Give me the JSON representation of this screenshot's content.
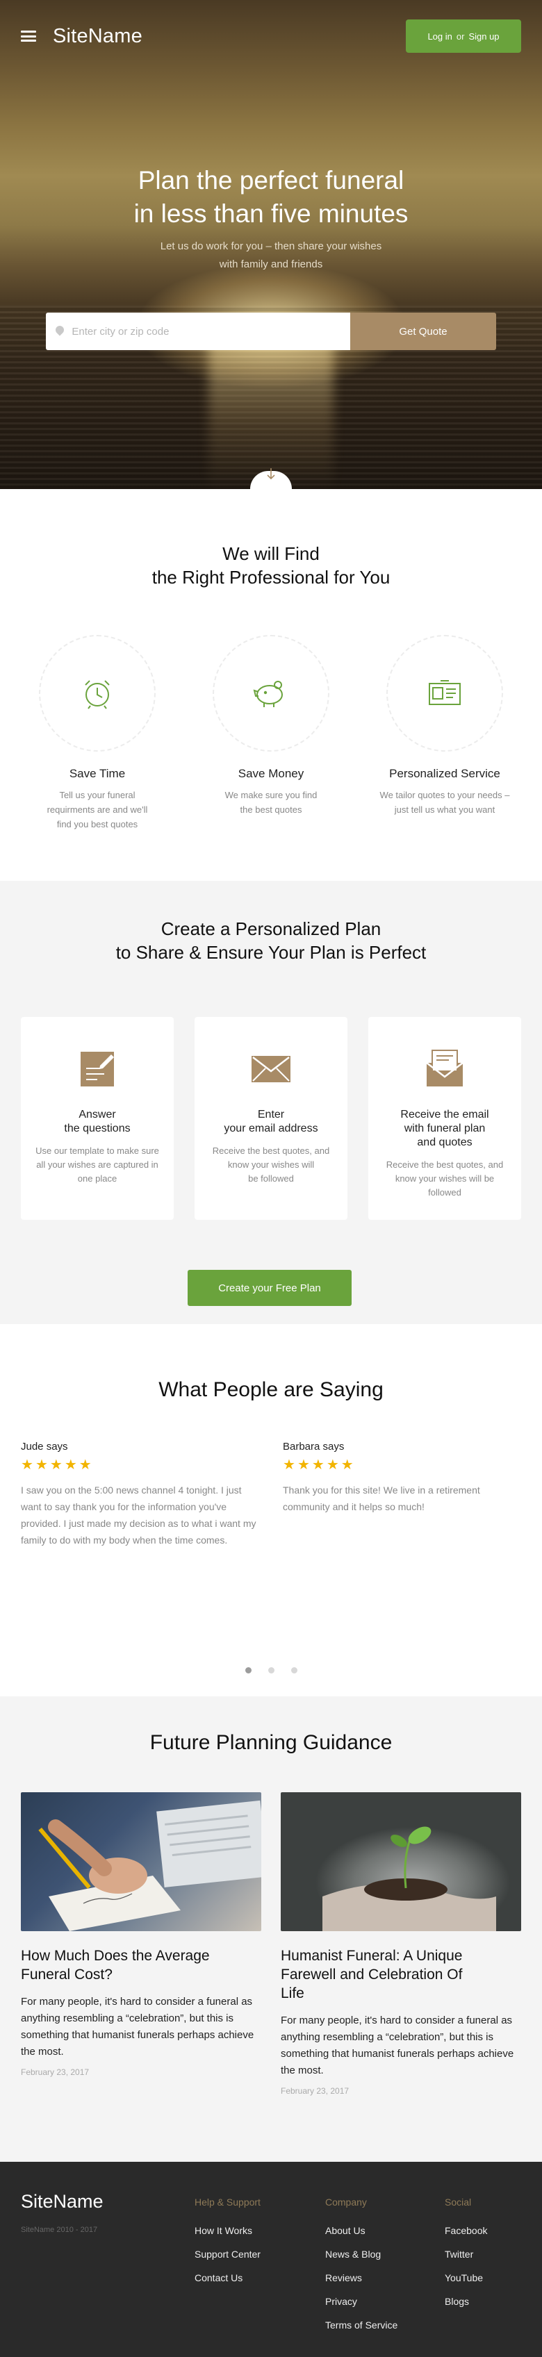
{
  "header": {
    "logo": "SiteName",
    "login": "Log in",
    "or": "or",
    "signup": "Sign up"
  },
  "hero": {
    "title_line1": "Plan the perfect funeral",
    "title_line2": "in less than five minutes",
    "sub_line1": "Let us do work for you – then share your wishes",
    "sub_line2": "with family and friends",
    "search_placeholder": "Enter city or zip code",
    "search_button": "Get Quote"
  },
  "find": {
    "title_line1": "We will Find",
    "title_line2": "the Right Professional for You",
    "features": [
      {
        "icon": "alarm-clock-icon",
        "title": "Save Time",
        "l1": "Tell us your funeral",
        "l2": "requirments are and we'll",
        "l3": "find you best quotes"
      },
      {
        "icon": "piggy-bank-icon",
        "title": "Save Money",
        "l1": "We make sure you find",
        "l2": "the best quotes",
        "l3": ""
      },
      {
        "icon": "id-card-icon",
        "title": "Personalized Service",
        "l1": "We tailor quotes to your needs –",
        "l2": "just tell us what you want",
        "l3": ""
      }
    ]
  },
  "plan": {
    "title_line1": "Create a Personalized Plan",
    "title_line2": "to Share & Ensure Your Plan is Perfect",
    "cards": [
      {
        "icon": "document-pen-icon",
        "t1": "Answer",
        "t2": "the questions",
        "t3": "",
        "d1": "Use our template to make sure",
        "d2": "all your wishes are captured in",
        "d3": "one place"
      },
      {
        "icon": "envelope-icon",
        "t1": "Enter",
        "t2": "your email address",
        "t3": "",
        "d1": "Receive the best quotes, and",
        "d2": "know your wishes will",
        "d3": "be followed"
      },
      {
        "icon": "email-letter-icon",
        "t1": "Receive the email",
        "t2": "with funeral plan",
        "t3": "and quotes",
        "d1": "Receive the best quotes, and",
        "d2": "know your wishes will be",
        "d3": "followed"
      }
    ],
    "cta": "Create your Free Plan"
  },
  "testimonials": {
    "title": "What People are Saying",
    "items": [
      {
        "name": "Jude says",
        "stars": 5,
        "text": "I saw you on the 5:00 news channel 4 tonight. I just want to say thank you for the information you've provided. I just made my decision as to what i want my family to do with my body when the time comes."
      },
      {
        "name": "Barbara says",
        "stars": 5,
        "text": "Thank you for this site! We live in a retirement community and it helps so much!"
      }
    ],
    "active_slide": 1,
    "slide_count": 3
  },
  "guidance": {
    "title": "Future Planning Guidance",
    "posts": [
      {
        "image": "hand-writing-photo",
        "title_line1": "How Much Does the Average",
        "title_line2": "Funeral Cost?",
        "title_line3": "",
        "text": "For many people, it's hard to consider a funeral as anything resembling a “celebration”, but this is something that humanist funerals perhaps achieve the most.",
        "date": "February 23, 2017"
      },
      {
        "image": "seedling-in-hands-photo",
        "title_line1": "Humanist Funeral: A Unique",
        "title_line2": "Farewell and Celebration Of",
        "title_line3": "Life",
        "text": "For many people, it's hard to consider a funeral as anything resembling a “celebration”, but this is something that humanist funerals perhaps achieve the most.",
        "date": "February 23, 2017"
      }
    ]
  },
  "footer": {
    "logo": "SiteName",
    "copyright": "SiteName 2010 - 2017",
    "columns": [
      {
        "heading": "Help & Support",
        "links": [
          "How It Works",
          "Support Center",
          "Contact Us"
        ]
      },
      {
        "heading": "Company",
        "links": [
          "About Us",
          "News & Blog",
          "Reviews",
          "Privacy",
          "Terms of Service"
        ]
      },
      {
        "heading": "Social",
        "links": [
          "Facebook",
          "Twitter",
          "YouTube",
          "Blogs"
        ]
      }
    ]
  },
  "colors": {
    "accent_green": "#6aa33c",
    "accent_brown": "#a88b66",
    "footer_bg": "#2a2a2a"
  }
}
